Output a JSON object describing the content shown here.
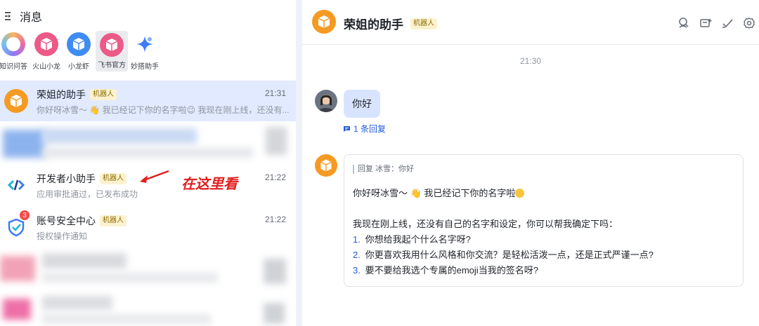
{
  "left_panel": {
    "title": "消息",
    "bots": [
      {
        "name": "知识问答",
        "color": "#b47cf5"
      },
      {
        "name": "火山小龙",
        "color": "#ec5a87"
      },
      {
        "name": "小龙虾",
        "color": "#3f8cf3"
      },
      {
        "name": "飞书官方",
        "color": "#ec5a87"
      },
      {
        "name": "妙搭助手",
        "color": "#3c7df2"
      }
    ],
    "conversations": [
      {
        "name": "荣姐的助手",
        "tag": "机器人",
        "time": "21:31",
        "preview": "你好呀冰雪～ 👋 我已经记下你的名字啦😉 我现在刚上线，还没有...",
        "avatar_color": "#f59a23",
        "selected": true
      },
      {
        "name": "开发者小助手",
        "tag": "机器人",
        "time": "21:22",
        "preview": "应用审批通过，已发布成功"
      },
      {
        "name": "账号安全中心",
        "tag": "机器人",
        "time": "21:22",
        "preview": "授权操作通知",
        "badge": "3"
      }
    ],
    "annotation": "在这里看"
  },
  "chat": {
    "title": "荣姐的助手",
    "tag": "机器人",
    "header_icons": [
      "search-icon",
      "add-tab-icon",
      "checkmark-icon",
      "settings-icon"
    ],
    "timestamp": "21:30",
    "user_message": "你好",
    "reply_count": "1 条回复",
    "bot_reply": {
      "quote": "回复 冰雪：你好",
      "greeting": "你好呀冰雪～ 👋 我已经记下你的名字啦",
      "intro": "我现在刚上线，还没有自己的名字和设定，你可以帮我确定下吗：",
      "items": [
        {
          "num": "1.",
          "text": "你想给我起个什么名字呀?"
        },
        {
          "num": "2.",
          "text": "你更喜欢我用什么风格和你交流？是轻松活泼一点，还是正式严谨一点?"
        },
        {
          "num": "3.",
          "text": "要不要给我选个专属的emoji当我的签名呀?"
        }
      ]
    }
  }
}
